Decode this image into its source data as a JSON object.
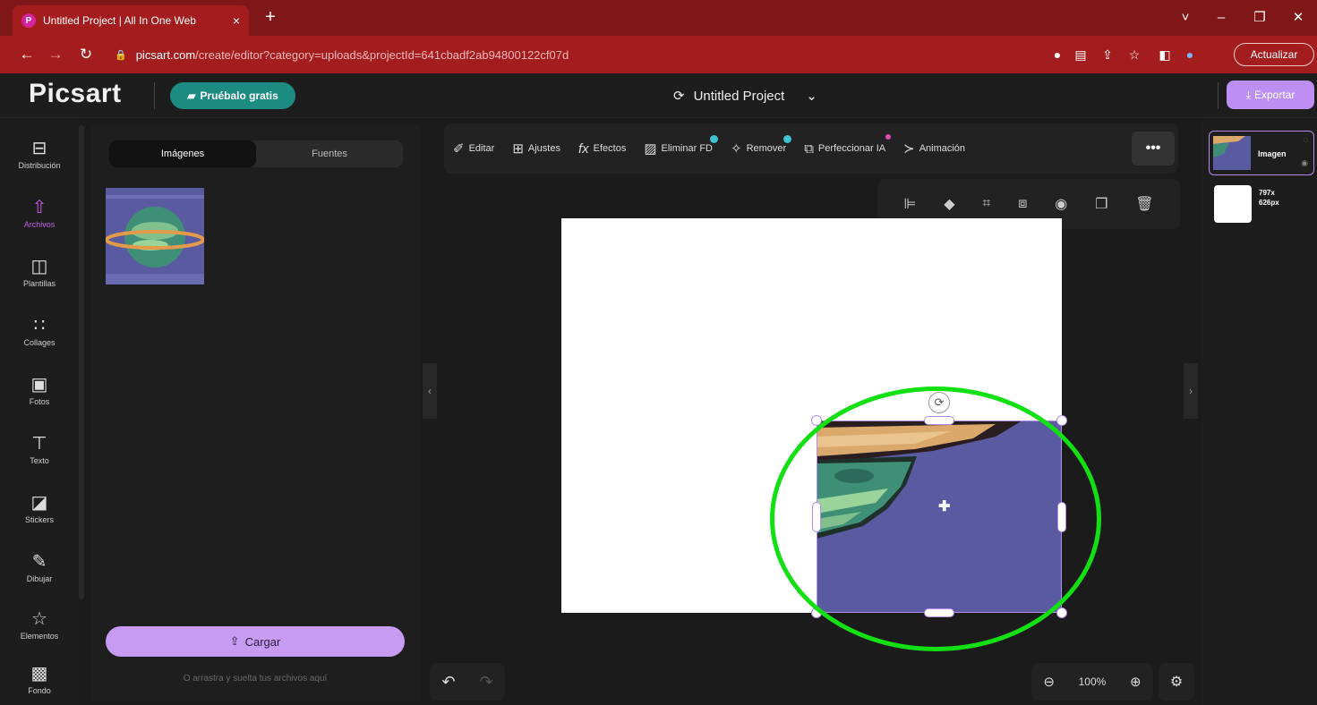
{
  "browser": {
    "tab_title": "Untitled Project | All In One Web",
    "tab_close": "×",
    "new_tab": "+",
    "url_host": "picsart.com",
    "url_path": "/create/editor?category=uploads&projectId=641cbadf2ab94800122cf07d",
    "update_label": "Actualizar",
    "window_controls": [
      "˅",
      "–",
      "❐",
      "✕"
    ]
  },
  "header": {
    "logo": "Picsart",
    "try_label": "Pruébalo gratis",
    "project_title": "Untitled Project",
    "export_label": "Exportar"
  },
  "rail": {
    "items": [
      {
        "label": "Distribución",
        "icon": "layout-icon"
      },
      {
        "label": "Archivos",
        "icon": "upload-icon"
      },
      {
        "label": "Plantillas",
        "icon": "templates-icon"
      },
      {
        "label": "Collages",
        "icon": "collage-icon"
      },
      {
        "label": "Fotos",
        "icon": "photo-icon"
      },
      {
        "label": "Texto",
        "icon": "text-icon"
      },
      {
        "label": "Stickers",
        "icon": "sticker-icon"
      },
      {
        "label": "Dibujar",
        "icon": "brush-icon"
      },
      {
        "label": "Elementos",
        "icon": "star-icon"
      },
      {
        "label": "Fondo",
        "icon": "background-icon"
      }
    ]
  },
  "leftpanel": {
    "tab_images": "Imágenes",
    "tab_fonts": "Fuentes",
    "upload_label": "Cargar",
    "drop_hint": "O arrastra y suelta tus archivos aquí"
  },
  "toolbar": {
    "items": [
      "Editar",
      "Ajustes",
      "Efectos",
      "Eliminar FD",
      "Remover",
      "Perfeccionar IA",
      "Animación"
    ],
    "more": "•••"
  },
  "zoom": {
    "level": "100%"
  },
  "layers": {
    "layer1_name": "Imagen",
    "layer2_name": "797x 626px"
  },
  "colors": {
    "accent": "#bd8ff3",
    "annotation_circle": "#12e012",
    "browser_red": "#a31d1e",
    "image_purple": "#5a5aa0"
  }
}
